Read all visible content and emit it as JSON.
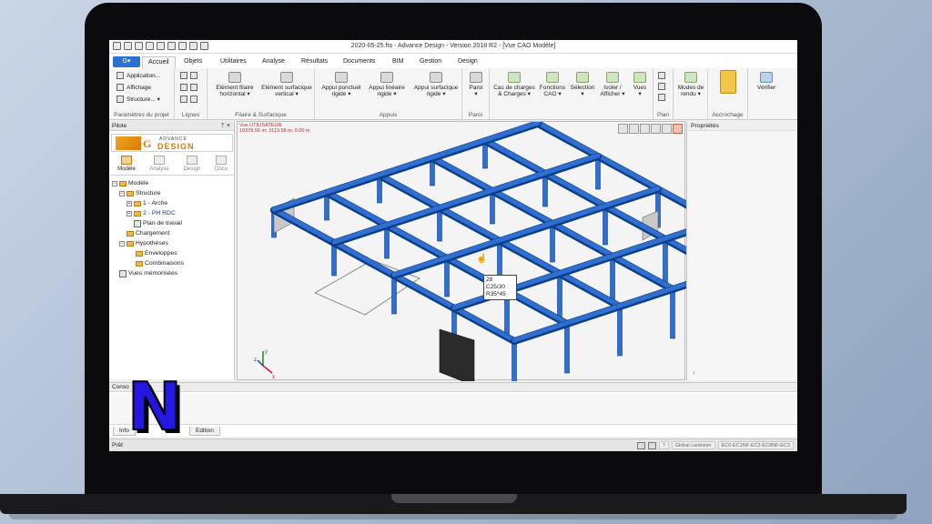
{
  "window": {
    "title": "2020-05-25.fto - Advance Design - Version 2018 R2 - [Vue CAO Modèle]",
    "app_button": "G▾"
  },
  "ribbon": {
    "tabs": [
      {
        "label": "Accueil",
        "active": true
      },
      {
        "label": "Objets",
        "active": false
      },
      {
        "label": "Utilitaires",
        "active": false
      },
      {
        "label": "Analyse",
        "active": false
      },
      {
        "label": "Résultats",
        "active": false
      },
      {
        "label": "Documents",
        "active": false
      },
      {
        "label": "BIM",
        "active": false
      },
      {
        "label": "Gestion",
        "active": false
      },
      {
        "label": "Design",
        "active": false
      }
    ],
    "params": {
      "application": "Application...",
      "affichage": "Affichage",
      "structure": "Structure... ▾",
      "group": "Paramètres du projet"
    },
    "lignes": {
      "group": "Lignes"
    },
    "filaire": {
      "btn1a": "Elément filaire",
      "btn1b": "horizontal ▾",
      "btn2a": "Elément surfacique",
      "btn2b": "vertical ▾",
      "group": "Filaire & Surfacique"
    },
    "appuis": {
      "btn1a": "Appui ponctuel",
      "btn1b": "rigide ▾",
      "btn2a": "Appui linéaire",
      "btn2b": "rigide ▾",
      "btn3a": "Appui surfacique",
      "btn3b": "rigide ▾",
      "group": "Appuis"
    },
    "paroi": {
      "btn": "Paroi",
      "arrow": "▾",
      "group": "Paroi"
    },
    "misc": {
      "cas1": "Cas de charges",
      "cas2": "& Charges ▾",
      "fonc1": "Fonctions",
      "fonc2": "CAO ▾",
      "sel1": "Sélection",
      "sel2": "▾",
      "iso1": "Isoler /",
      "iso2": "Afficher ▾",
      "vues1": "Vues",
      "vues2": "▾"
    },
    "plan": {
      "group": "Plan"
    },
    "rendu": {
      "btn1": "Modes de",
      "btn2": "rendu ▾"
    },
    "accrochage": {
      "group": "Accrochage"
    },
    "verifier": {
      "btn": "Vérifier"
    }
  },
  "pilot": {
    "title": "Pilote",
    "pin": "ᛘ ×",
    "logo_top": "ADVANCE",
    "logo_bottom": "DESIGN",
    "modes": [
      "Modèle",
      "Analyse",
      "Design",
      "Docu"
    ],
    "tree": [
      {
        "label": "Modèle",
        "level": 0,
        "expander": "−"
      },
      {
        "label": "Structure",
        "level": 1,
        "expander": "−"
      },
      {
        "label": "1 - Arche",
        "level": 2,
        "expander": "+"
      },
      {
        "label": "2 - PH RDC",
        "level": 2,
        "expander": "+",
        "selected": true
      },
      {
        "label": "Plan de travail",
        "level": 2,
        "expander": ""
      },
      {
        "label": "Chargement",
        "level": 1,
        "expander": ""
      },
      {
        "label": "Hypothèses",
        "level": 1,
        "expander": "−"
      },
      {
        "label": "Enveloppes",
        "level": 2,
        "expander": ""
      },
      {
        "label": "Combinaisons",
        "level": 2,
        "expander": ""
      },
      {
        "label": "Vues mémorisées",
        "level": 0,
        "expander": ""
      }
    ]
  },
  "viewport": {
    "view_name": "Vue UTILISATEUR",
    "coords": "19378.56 m; 3113.58 m; 0.00 m",
    "tooltip": {
      "line1": "28",
      "line2": "C25/30",
      "line3": "R35*45"
    },
    "axes": {
      "y": "y",
      "z": "z",
      "x": "x"
    }
  },
  "properties": {
    "title": "Propriétés",
    "collapse": "‹"
  },
  "console": {
    "title": "Conso",
    "tab_info": "Info",
    "tab_edition": "Edition"
  },
  "watermark": {
    "letter": "N"
  },
  "status": {
    "ready": "Prêt",
    "cell1": "Global cartésien",
    "cell2": "EC0-EC1NF-EC2-EC8NF-EC3",
    "separator": "?"
  },
  "colors": {
    "beam": "#2f6fd1",
    "beam_dark": "#0d3d86",
    "wall": "#c8c8c8",
    "accent": "#2a6fd1"
  }
}
